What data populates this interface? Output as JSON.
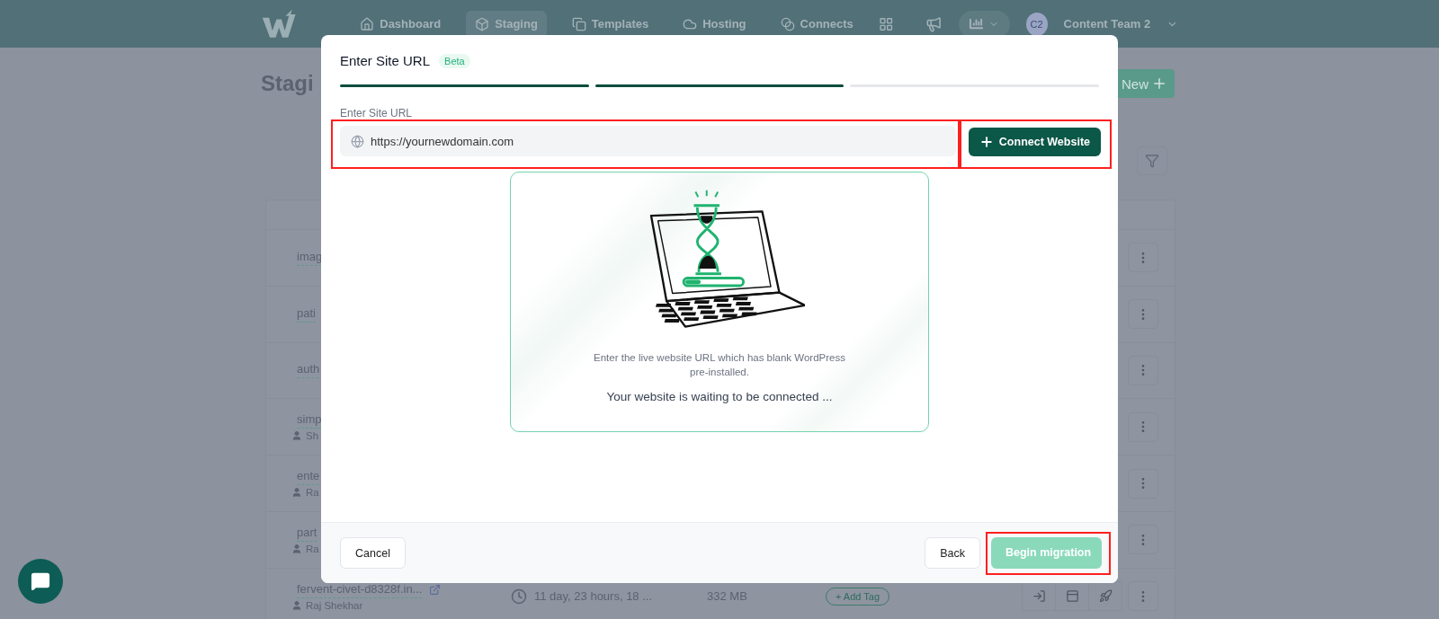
{
  "nav": {
    "items": [
      {
        "label": "Dashboard",
        "selected": false
      },
      {
        "label": "Staging",
        "selected": true
      },
      {
        "label": "Templates",
        "selected": false
      },
      {
        "label": "Hosting",
        "selected": false
      },
      {
        "label": "Connects",
        "selected": false
      }
    ],
    "account": {
      "initials": "C2",
      "name": "Content Team 2"
    }
  },
  "page": {
    "title": "Stagi",
    "new_button": "New"
  },
  "table": {
    "rows": [
      {
        "name": "imag"
      },
      {
        "name": "pati"
      },
      {
        "name": "auth"
      },
      {
        "name": "simp",
        "owner": "Sh"
      },
      {
        "name": "ente",
        "owner": "Ra"
      },
      {
        "name": "part",
        "owner": "Ra"
      },
      {
        "name": "fervent-civet-d8328f.in...",
        "owner": "Raj Shekhar",
        "age": "11 day, 23 hours, 18 ...",
        "size": "332 MB",
        "tag_button": "+ Add Tag"
      }
    ]
  },
  "modal": {
    "title": "Enter Site URL",
    "badge": "Beta",
    "steps": [
      {
        "complete": true
      },
      {
        "complete": true
      },
      {
        "complete": false
      }
    ],
    "url_label": "Enter Site URL",
    "url_field": {
      "value": "https://yournewdomain.com",
      "highlighted": true
    },
    "connect_button": {
      "label": "Connect Website",
      "highlighted": true
    },
    "hint": "Enter the live website URL which has blank WordPress pre-installed.",
    "status": "Your website is waiting to be connected ...",
    "buttons": [
      {
        "label": "Cancel",
        "kind": "secondary",
        "disabled": false,
        "highlighted": false
      },
      {
        "label": "Back",
        "kind": "secondary",
        "disabled": false,
        "highlighted": false
      },
      {
        "label": "Begin migration",
        "kind": "primary",
        "disabled": true,
        "highlighted": true
      }
    ]
  }
}
